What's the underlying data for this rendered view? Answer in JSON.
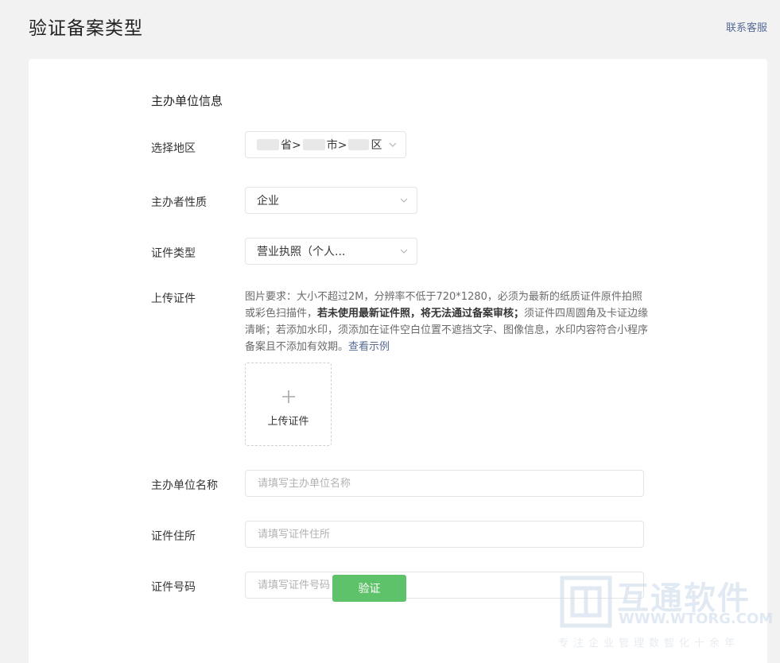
{
  "header": {
    "title": "验证备案类型",
    "support_link": "联系客服"
  },
  "form": {
    "section_title": "主办单位信息",
    "region": {
      "label": "选择地区",
      "province_suffix": "省>",
      "city_suffix": "市>",
      "district_suffix": "区"
    },
    "nature": {
      "label": "主办者性质",
      "value": "企业"
    },
    "cert_type": {
      "label": "证件类型",
      "value": "营业执照（个人..."
    },
    "upload": {
      "label": "上传证件",
      "hint_part1": "图片要求：大小不超过2M，分辨率不低于720*1280，必须为最新的纸质证件原件拍照或彩色扫描件，",
      "hint_bold": "若未使用最新证件照，将无法通过备案审核；",
      "hint_part2": "须证件四周圆角及卡证边缘清晰；若添加水印，须添加在证件空白位置不遮挡文字、图像信息，水印内容符合小程序备案且不添加有效期。",
      "example_link": "查看示例",
      "button_text": "上传证件"
    },
    "org_name": {
      "label": "主办单位名称",
      "placeholder": "请填写主办单位名称"
    },
    "address": {
      "label": "证件住所",
      "placeholder": "请填写证件住所"
    },
    "cert_number": {
      "label": "证件号码",
      "placeholder": "请填写证件号码"
    },
    "submit_label": "验证"
  },
  "watermark": {
    "name": "互通软件",
    "url": "WWW.WTORG.COM",
    "slogan": "专注企业管理数智化十余年"
  },
  "colors": {
    "accent_green": "#5ec26a",
    "link_blue": "#576b95",
    "background": "#f2f2f2"
  }
}
